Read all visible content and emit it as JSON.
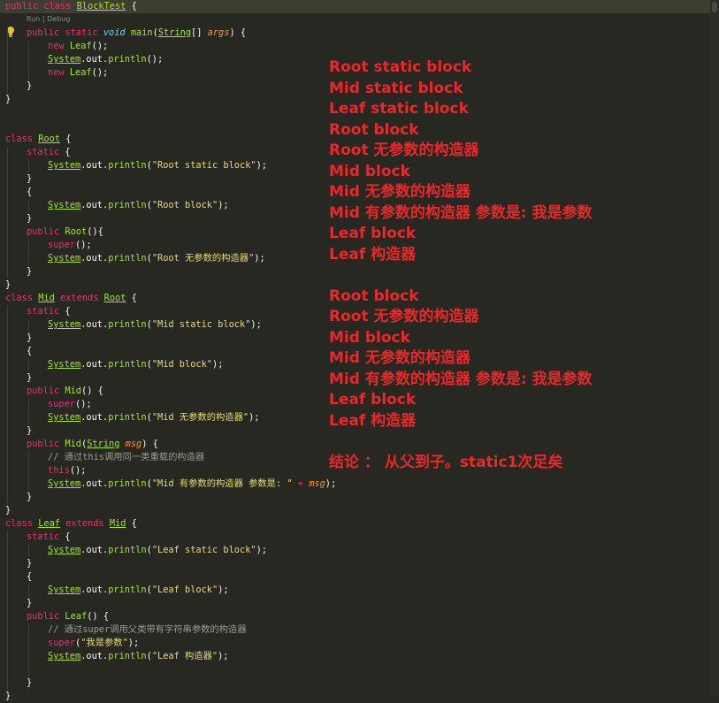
{
  "codelens": {
    "run": "Run",
    "separator": " | ",
    "debug": "Debug"
  },
  "code_lines": [
    {
      "row": 0,
      "indent": 0,
      "hl": true,
      "tokens": [
        [
          "public",
          "kw"
        ],
        [
          " ",
          "pl"
        ],
        [
          "class",
          "kw"
        ],
        [
          " ",
          "pl"
        ],
        [
          "BlockTest",
          "clsu"
        ],
        [
          " {",
          "pl"
        ]
      ]
    },
    {
      "row": 2,
      "indent": 1,
      "tokens": [
        [
          "public",
          "kw"
        ],
        [
          " ",
          "pl"
        ],
        [
          "static",
          "kw"
        ],
        [
          " ",
          "pl"
        ],
        [
          "void",
          "ital"
        ],
        [
          " ",
          "pl"
        ],
        [
          "main",
          "fn"
        ],
        [
          "(",
          "pl"
        ],
        [
          "String",
          "clsu"
        ],
        [
          "[] ",
          "pl"
        ],
        [
          "args",
          "par"
        ],
        [
          ") {",
          "pl"
        ]
      ]
    },
    {
      "row": 3,
      "indent": 2,
      "tokens": [
        [
          "new",
          "kw"
        ],
        [
          " ",
          "pl"
        ],
        [
          "Leaf",
          "fn"
        ],
        [
          "();",
          "pl"
        ]
      ]
    },
    {
      "row": 4,
      "indent": 2,
      "tokens": [
        [
          "System",
          "clsu"
        ],
        [
          ".out.",
          "pl"
        ],
        [
          "println",
          "fn"
        ],
        [
          "();",
          "pl"
        ]
      ]
    },
    {
      "row": 5,
      "indent": 2,
      "tokens": [
        [
          "new",
          "kw"
        ],
        [
          " ",
          "pl"
        ],
        [
          "Leaf",
          "fn"
        ],
        [
          "();",
          "pl"
        ]
      ]
    },
    {
      "row": 6,
      "indent": 1,
      "tokens": [
        [
          "}",
          "pl"
        ]
      ]
    },
    {
      "row": 7,
      "indent": 0,
      "tokens": [
        [
          "}",
          "pl"
        ]
      ]
    },
    {
      "row": 10,
      "indent": 0,
      "tokens": [
        [
          "class",
          "kw"
        ],
        [
          " ",
          "pl"
        ],
        [
          "Root",
          "clsu"
        ],
        [
          " {",
          "pl"
        ]
      ]
    },
    {
      "row": 11,
      "indent": 1,
      "tokens": [
        [
          "static",
          "kw"
        ],
        [
          " {",
          "pl"
        ]
      ]
    },
    {
      "row": 12,
      "indent": 2,
      "tokens": [
        [
          "System",
          "clsu"
        ],
        [
          ".out.",
          "pl"
        ],
        [
          "println",
          "fn"
        ],
        [
          "(",
          "pl"
        ],
        [
          "\"Root static block\"",
          "str"
        ],
        [
          ");",
          "pl"
        ]
      ]
    },
    {
      "row": 13,
      "indent": 1,
      "tokens": [
        [
          "}",
          "pl"
        ]
      ]
    },
    {
      "row": 14,
      "indent": 1,
      "tokens": [
        [
          "{",
          "pl"
        ]
      ]
    },
    {
      "row": 15,
      "indent": 2,
      "tokens": [
        [
          "System",
          "clsu"
        ],
        [
          ".out.",
          "pl"
        ],
        [
          "println",
          "fn"
        ],
        [
          "(",
          "pl"
        ],
        [
          "\"Root block\"",
          "str"
        ],
        [
          ");",
          "pl"
        ]
      ]
    },
    {
      "row": 16,
      "indent": 1,
      "tokens": [
        [
          "}",
          "pl"
        ]
      ]
    },
    {
      "row": 17,
      "indent": 1,
      "tokens": [
        [
          "public",
          "kw"
        ],
        [
          " ",
          "pl"
        ],
        [
          "Root",
          "fn"
        ],
        [
          "(){",
          "pl"
        ]
      ]
    },
    {
      "row": 18,
      "indent": 2,
      "tokens": [
        [
          "super",
          "kw"
        ],
        [
          "();",
          "pl"
        ]
      ]
    },
    {
      "row": 19,
      "indent": 2,
      "tokens": [
        [
          "System",
          "clsu"
        ],
        [
          ".out.",
          "pl"
        ],
        [
          "println",
          "fn"
        ],
        [
          "(",
          "pl"
        ],
        [
          "\"Root 无参数的构造器\"",
          "str"
        ],
        [
          ");",
          "pl"
        ]
      ]
    },
    {
      "row": 20,
      "indent": 1,
      "tokens": [
        [
          "}",
          "pl"
        ]
      ]
    },
    {
      "row": 21,
      "indent": 0,
      "tokens": [
        [
          "}",
          "pl"
        ]
      ]
    },
    {
      "row": 22,
      "indent": 0,
      "tokens": [
        [
          "class",
          "kw"
        ],
        [
          " ",
          "pl"
        ],
        [
          "Mid",
          "clsu"
        ],
        [
          " ",
          "pl"
        ],
        [
          "extends",
          "kw"
        ],
        [
          " ",
          "pl"
        ],
        [
          "Root",
          "clsu"
        ],
        [
          " {",
          "pl"
        ]
      ]
    },
    {
      "row": 23,
      "indent": 1,
      "tokens": [
        [
          "static",
          "kw"
        ],
        [
          " {",
          "pl"
        ]
      ]
    },
    {
      "row": 24,
      "indent": 2,
      "tokens": [
        [
          "System",
          "clsu"
        ],
        [
          ".out.",
          "pl"
        ],
        [
          "println",
          "fn"
        ],
        [
          "(",
          "pl"
        ],
        [
          "\"Mid static block\"",
          "str"
        ],
        [
          ");",
          "pl"
        ]
      ]
    },
    {
      "row": 25,
      "indent": 1,
      "tokens": [
        [
          "}",
          "pl"
        ]
      ]
    },
    {
      "row": 26,
      "indent": 1,
      "tokens": [
        [
          "{",
          "pl"
        ]
      ]
    },
    {
      "row": 27,
      "indent": 2,
      "tokens": [
        [
          "System",
          "clsu"
        ],
        [
          ".out.",
          "pl"
        ],
        [
          "println",
          "fn"
        ],
        [
          "(",
          "pl"
        ],
        [
          "\"Mid block\"",
          "str"
        ],
        [
          ");",
          "pl"
        ]
      ]
    },
    {
      "row": 28,
      "indent": 1,
      "tokens": [
        [
          "}",
          "pl"
        ]
      ]
    },
    {
      "row": 29,
      "indent": 1,
      "tokens": [
        [
          "public",
          "kw"
        ],
        [
          " ",
          "pl"
        ],
        [
          "Mid",
          "fn"
        ],
        [
          "() {",
          "pl"
        ]
      ]
    },
    {
      "row": 30,
      "indent": 2,
      "tokens": [
        [
          "super",
          "kw"
        ],
        [
          "();",
          "pl"
        ]
      ]
    },
    {
      "row": 31,
      "indent": 2,
      "tokens": [
        [
          "System",
          "clsu"
        ],
        [
          ".out.",
          "pl"
        ],
        [
          "println",
          "fn"
        ],
        [
          "(",
          "pl"
        ],
        [
          "\"Mid 无参数的构造器\"",
          "str"
        ],
        [
          ");",
          "pl"
        ]
      ]
    },
    {
      "row": 32,
      "indent": 1,
      "tokens": [
        [
          "}",
          "pl"
        ]
      ]
    },
    {
      "row": 33,
      "indent": 1,
      "tokens": [
        [
          "public",
          "kw"
        ],
        [
          " ",
          "pl"
        ],
        [
          "Mid",
          "fn"
        ],
        [
          "(",
          "pl"
        ],
        [
          "String",
          "clsu"
        ],
        [
          " ",
          "pl"
        ],
        [
          "msg",
          "par"
        ],
        [
          ") {",
          "pl"
        ]
      ]
    },
    {
      "row": 34,
      "indent": 2,
      "tokens": [
        [
          "// 通过this调用同一类重载的构造器",
          "com"
        ]
      ]
    },
    {
      "row": 35,
      "indent": 2,
      "tokens": [
        [
          "this",
          "kw"
        ],
        [
          "();",
          "pl"
        ]
      ]
    },
    {
      "row": 36,
      "indent": 2,
      "tokens": [
        [
          "System",
          "clsu"
        ],
        [
          ".out.",
          "pl"
        ],
        [
          "println",
          "fn"
        ],
        [
          "(",
          "pl"
        ],
        [
          "\"Mid 有参数的构造器 参数是: \"",
          "str"
        ],
        [
          " ",
          "pl"
        ],
        [
          "+",
          "kw"
        ],
        [
          " ",
          "pl"
        ],
        [
          "msg",
          "par"
        ],
        [
          ");",
          "pl"
        ]
      ]
    },
    {
      "row": 37,
      "indent": 1,
      "tokens": [
        [
          "}",
          "pl"
        ]
      ]
    },
    {
      "row": 38,
      "indent": 0,
      "tokens": [
        [
          "}",
          "pl"
        ]
      ]
    },
    {
      "row": 39,
      "indent": 0,
      "tokens": [
        [
          "class",
          "kw"
        ],
        [
          " ",
          "pl"
        ],
        [
          "Leaf",
          "clsu"
        ],
        [
          " ",
          "pl"
        ],
        [
          "extends",
          "kw"
        ],
        [
          " ",
          "pl"
        ],
        [
          "Mid",
          "clsu"
        ],
        [
          " {",
          "pl"
        ]
      ]
    },
    {
      "row": 40,
      "indent": 1,
      "tokens": [
        [
          "static",
          "kw"
        ],
        [
          " {",
          "pl"
        ]
      ]
    },
    {
      "row": 41,
      "indent": 2,
      "tokens": [
        [
          "System",
          "clsu"
        ],
        [
          ".out.",
          "pl"
        ],
        [
          "println",
          "fn"
        ],
        [
          "(",
          "pl"
        ],
        [
          "\"Leaf static block\"",
          "str"
        ],
        [
          ");",
          "pl"
        ]
      ]
    },
    {
      "row": 42,
      "indent": 1,
      "tokens": [
        [
          "}",
          "pl"
        ]
      ]
    },
    {
      "row": 43,
      "indent": 1,
      "tokens": [
        [
          "{",
          "pl"
        ]
      ]
    },
    {
      "row": 44,
      "indent": 2,
      "tokens": [
        [
          "System",
          "clsu"
        ],
        [
          ".out.",
          "pl"
        ],
        [
          "println",
          "fn"
        ],
        [
          "(",
          "pl"
        ],
        [
          "\"Leaf block\"",
          "str"
        ],
        [
          ");",
          "pl"
        ]
      ]
    },
    {
      "row": 45,
      "indent": 1,
      "tokens": [
        [
          "}",
          "pl"
        ]
      ]
    },
    {
      "row": 46,
      "indent": 1,
      "tokens": [
        [
          "public",
          "kw"
        ],
        [
          " ",
          "pl"
        ],
        [
          "Leaf",
          "fn"
        ],
        [
          "() {",
          "pl"
        ]
      ]
    },
    {
      "row": 47,
      "indent": 2,
      "tokens": [
        [
          "// 通过super调用父类带有字符串参数的构造器",
          "com"
        ]
      ]
    },
    {
      "row": 48,
      "indent": 2,
      "tokens": [
        [
          "super",
          "kw"
        ],
        [
          "(",
          "pl"
        ],
        [
          "\"我是参数\"",
          "str"
        ],
        [
          ");",
          "pl"
        ]
      ]
    },
    {
      "row": 49,
      "indent": 2,
      "tokens": [
        [
          "System",
          "clsu"
        ],
        [
          ".out.",
          "pl"
        ],
        [
          "println",
          "fn"
        ],
        [
          "(",
          "pl"
        ],
        [
          "\"Leaf 构造器\"",
          "str"
        ],
        [
          ");",
          "pl"
        ]
      ]
    },
    {
      "row": 51,
      "indent": 1,
      "tokens": [
        [
          "}",
          "pl"
        ]
      ]
    },
    {
      "row": 52,
      "indent": 0,
      "tokens": [
        [
          "}",
          "pl"
        ]
      ]
    }
  ],
  "notes": [
    "Root static block",
    "Mid static block",
    "Leaf static block",
    "Root block",
    "Root 无参数的构造器",
    "Mid block",
    "Mid 无参数的构造器",
    "Mid 有参数的构造器 参数是: 我是参数",
    "Leaf block",
    "Leaf 构造器",
    "",
    "Root block",
    "Root 无参数的构造器",
    "Mid block",
    "Mid 无参数的构造器",
    "Mid 有参数的构造器 参数是: 我是参数",
    "Leaf block",
    "Leaf 构造器",
    "",
    "结论 ： 从父到子。static1次足矣"
  ],
  "icons": {
    "bulb": "lightbulb-icon"
  },
  "colors": {
    "note": "#e8282a",
    "background": "#272822"
  }
}
